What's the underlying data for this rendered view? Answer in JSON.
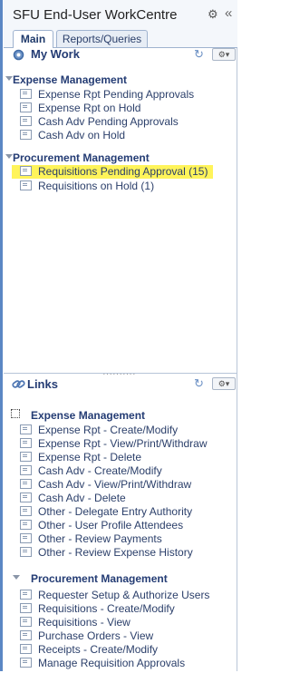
{
  "window": {
    "title": "SFU End-User WorkCentre"
  },
  "tabs": [
    {
      "label": "Main"
    },
    {
      "label": "Reports/Queries"
    }
  ],
  "my_work": {
    "title": "My Work",
    "groups": [
      {
        "label": "Expense Management",
        "items": [
          "Expense Rpt Pending Approvals",
          "Expense Rpt on Hold",
          "Cash Adv Pending Approvals",
          "Cash Adv on Hold"
        ]
      },
      {
        "label": "Procurement Management",
        "items": [
          "Requisitions Pending Approval (15)",
          "Requisitions on Hold (1)"
        ]
      }
    ]
  },
  "divider": {
    "text": "··········"
  },
  "links": {
    "title": "Links",
    "groups": [
      {
        "label": "Expense Management",
        "items": [
          "Expense Rpt - Create/Modify",
          "Expense Rpt - View/Print/Withdraw",
          "Expense Rpt - Delete",
          "Cash Adv - Create/Modify",
          "Cash Adv - View/Print/Withdraw",
          "Cash Adv - Delete",
          "Other - Delegate Entry Authority",
          "Other - User Profile Attendees",
          "Other - Review Payments",
          "Other - Review Expense History"
        ]
      },
      {
        "label": "Procurement Management",
        "items": [
          "Requester Setup & Authorize Users",
          "Requisitions - Create/Modify",
          "Requisitions - View",
          "Purchase Orders - View",
          "Receipts - Create/Modify",
          "Manage Requisition Approvals"
        ]
      }
    ]
  },
  "icons": {
    "settings": "gear-icon",
    "collapse": "double-chevron-left-icon",
    "refresh": "refresh-icon",
    "options": "gear-dropdown-icon"
  },
  "colors": {
    "highlight": "#fff45a",
    "accent_border": "#5b87c4"
  }
}
